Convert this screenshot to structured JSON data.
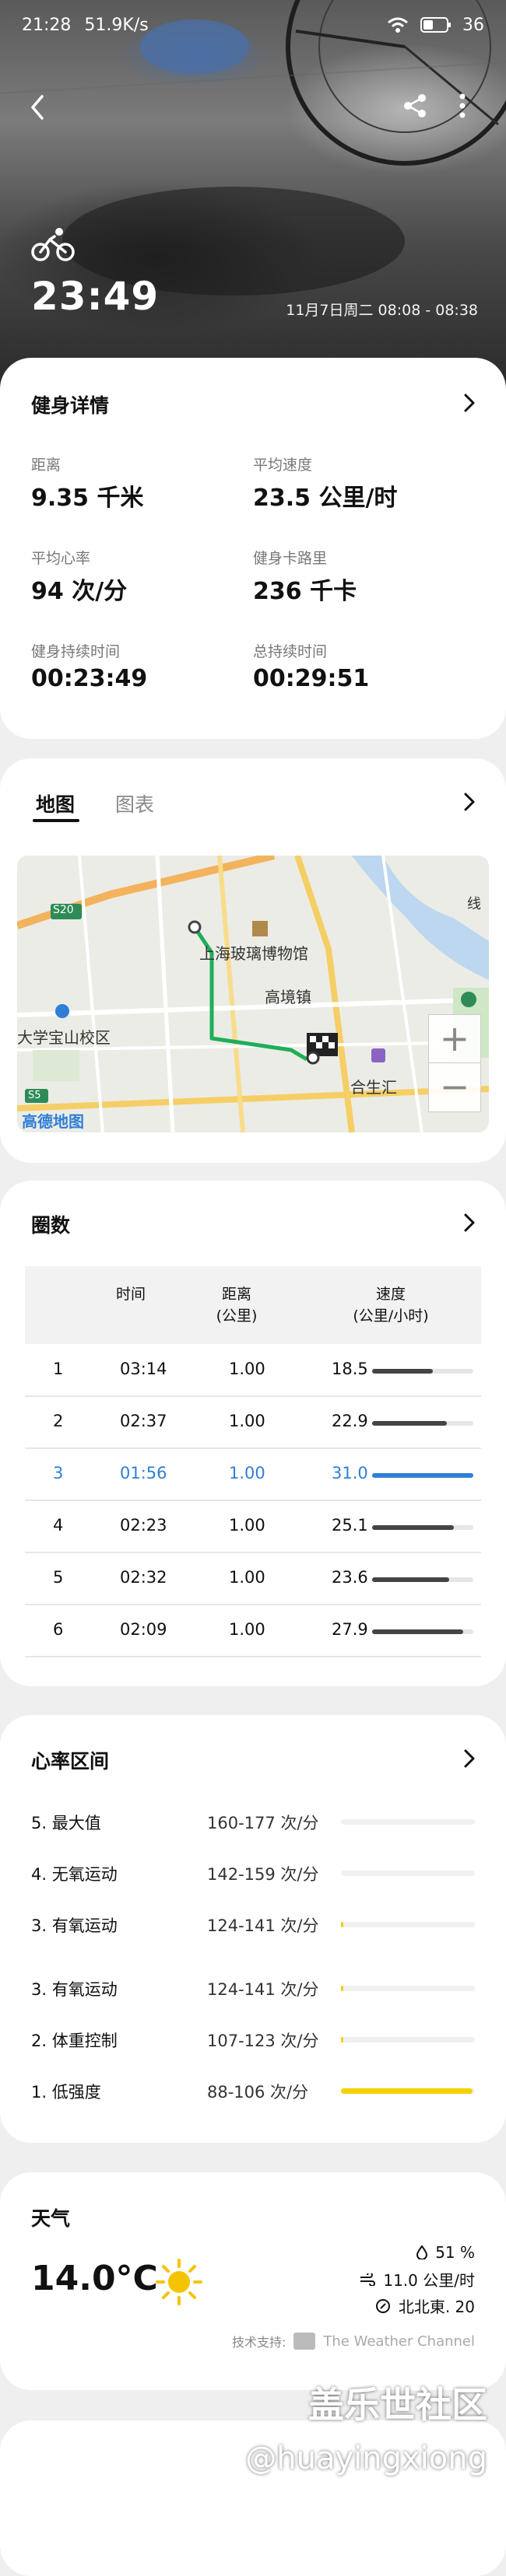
{
  "status_bar": {
    "time": "21:28",
    "net_speed": "51.9K/s",
    "battery": "36"
  },
  "header": {
    "duration": "23:49",
    "datetime": "11月7日周二 08:08 - 08:38"
  },
  "icons": [
    "back-icon",
    "share-icon",
    "more-icon",
    "bike-icon",
    "chevron-right-icon",
    "zoom-in-icon",
    "zoom-out-icon",
    "sun-icon",
    "humidity-icon",
    "wind-icon",
    "compass-icon",
    "weather-channel-logo"
  ],
  "fitness": {
    "title": "健身详情",
    "stats": [
      {
        "label": "距离",
        "value": "9.35 千米"
      },
      {
        "label": "平均速度",
        "value": "23.5 公里/时"
      },
      {
        "label": "平均心率",
        "value": "94 次/分"
      },
      {
        "label": "健身卡路里",
        "value": "236 千卡"
      },
      {
        "label": "健身持续时间",
        "value": "00:23:49"
      },
      {
        "label": "总持续时间",
        "value": "00:29:51"
      }
    ]
  },
  "map_card": {
    "tabs": [
      "地图",
      "图表"
    ],
    "active_tab": "地图",
    "map_labels": {
      "s20": "S20",
      "s5": "S5",
      "museum": "上海玻璃博物馆",
      "town": "高境镇",
      "campus": "大学宝山校区",
      "area": "合生汇",
      "logo": "高德地图",
      "line": "线",
      "zoom_in": "+",
      "zoom_out": "−"
    }
  },
  "laps": {
    "title": "圈数",
    "headers": {
      "time": "时间",
      "distance": "距离",
      "distance_unit": "(公里)",
      "speed": "速度",
      "speed_unit": "(公里/小时)"
    },
    "rows": [
      {
        "n": "1",
        "time": "03:14",
        "dist": "1.00",
        "speed": "18.5",
        "pct": 0.6
      },
      {
        "n": "2",
        "time": "02:37",
        "dist": "1.00",
        "speed": "22.9",
        "pct": 0.74
      },
      {
        "n": "3",
        "time": "01:56",
        "dist": "1.00",
        "speed": "31.0",
        "pct": 1.0,
        "highlight": true
      },
      {
        "n": "4",
        "time": "02:23",
        "dist": "1.00",
        "speed": "25.1",
        "pct": 0.81
      },
      {
        "n": "5",
        "time": "02:32",
        "dist": "1.00",
        "speed": "23.6",
        "pct": 0.76
      },
      {
        "n": "6",
        "time": "02:09",
        "dist": "1.00",
        "speed": "27.9",
        "pct": 0.9
      }
    ],
    "highlight_color": "#2f7fd6"
  },
  "heart_zones": {
    "title": "心率区间",
    "zones": [
      {
        "name": "5. 最大值",
        "range": "160-177 次/分",
        "pct": 0.0
      },
      {
        "name": "4. 无氧运动",
        "range": "142-159 次/分",
        "pct": 0.0
      },
      {
        "name": "3. 有氧运动",
        "range": "124-141 次/分",
        "pct": 0.01
      },
      {
        "name": "3. 有氧运动",
        "range": "124-141 次/分",
        "pct": 0.01
      },
      {
        "name": "2. 体重控制",
        "range": "107-123 次/分",
        "pct": 0.01
      },
      {
        "name": "1. 低强度",
        "range": "88-106 次/分",
        "pct": 0.98
      }
    ],
    "bar_color": "#f5d000"
  },
  "weather": {
    "title": "天气",
    "temperature": "14.0°C",
    "humidity": "51 %",
    "wind_speed": "11.0 公里/时",
    "wind_dir": "北北東. 20",
    "credit_label": "技术支持:",
    "credit_brand": "The Weather Channel"
  },
  "watermark": {
    "line1": "盖乐世社区",
    "line2": "@huayingxiong"
  }
}
